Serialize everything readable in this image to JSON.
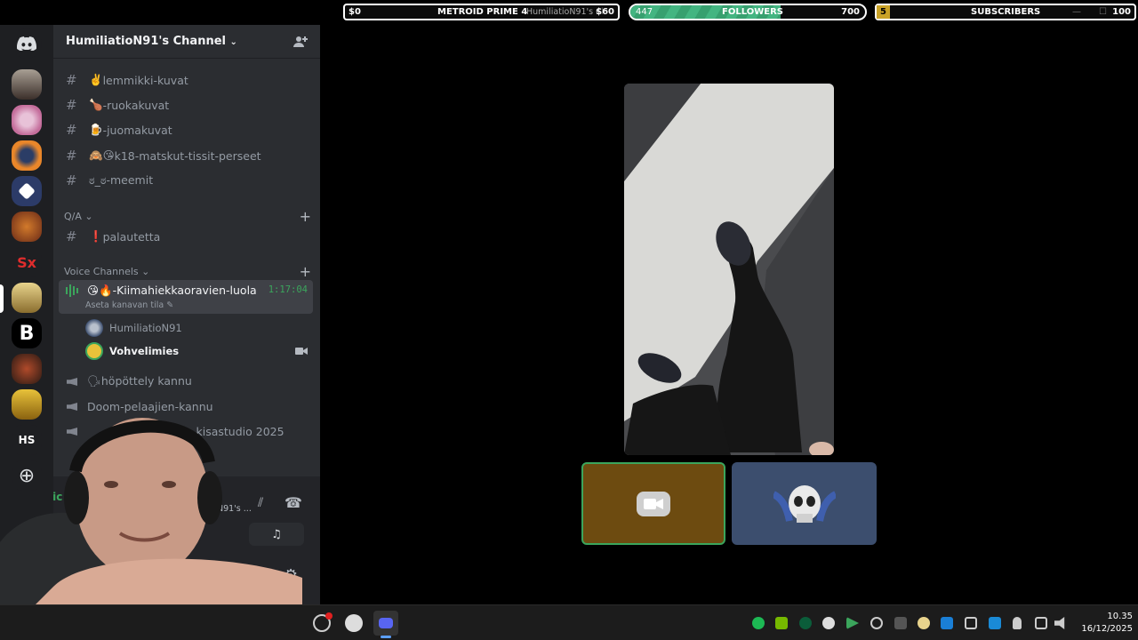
{
  "overlay": {
    "game_left_value": "$0",
    "game_title": "METROID PRIME 4",
    "window_title": "HumiliatioN91's Channel",
    "game_right_value": "$60",
    "followers_current": "447",
    "followers_label": "FOLLOWERS",
    "followers_goal": "700",
    "followers_progress": 0.64,
    "subs_current": "5",
    "subs_label": "SUBSCRIBERS",
    "subs_goal": "100",
    "subs_progress": 0.05
  },
  "server": {
    "name": "HumiliatioN91's Channel",
    "rail_initials": "HS"
  },
  "channels": [
    {
      "emoji": "✌️",
      "name": "lemmikki-kuvat"
    },
    {
      "emoji": "🍗",
      "name": "-ruokakuvat"
    },
    {
      "emoji": "🍺",
      "name": "-juomakuvat"
    },
    {
      "emoji": "🙈😘",
      "name": "k18-matskut-tissit-perseet"
    },
    {
      "emoji": "",
      "name": "ಠ_ಠ-meemit"
    }
  ],
  "categories": {
    "qa": "Q/A",
    "voice": "Voice Channels"
  },
  "qa_channel": {
    "emoji": "❗",
    "name": "palautetta"
  },
  "active_voice": {
    "name": "😘🔥-Kiimahiekkaoravien-luola",
    "timer": "1:17:04",
    "status_hint": "Aseta kanavan tila"
  },
  "voice_users": [
    "HumiliatioN91",
    "Vohvelimies"
  ],
  "voice_channels": [
    "🗣höpöttely kannu",
    "Doom-pelaajien-kannu",
    "…kisastudio 2025"
  ],
  "voice_status": {
    "connected_short": "Vic",
    "channel_short": "N91's ..."
  },
  "taskbar": {
    "time": "10.35",
    "date": "16/12/2025"
  },
  "colors": {
    "accent_green": "#3ba55c",
    "discord_blurple": "#5865f2",
    "followers_bar": "#43b581",
    "subs_bar": "#c9a227"
  }
}
